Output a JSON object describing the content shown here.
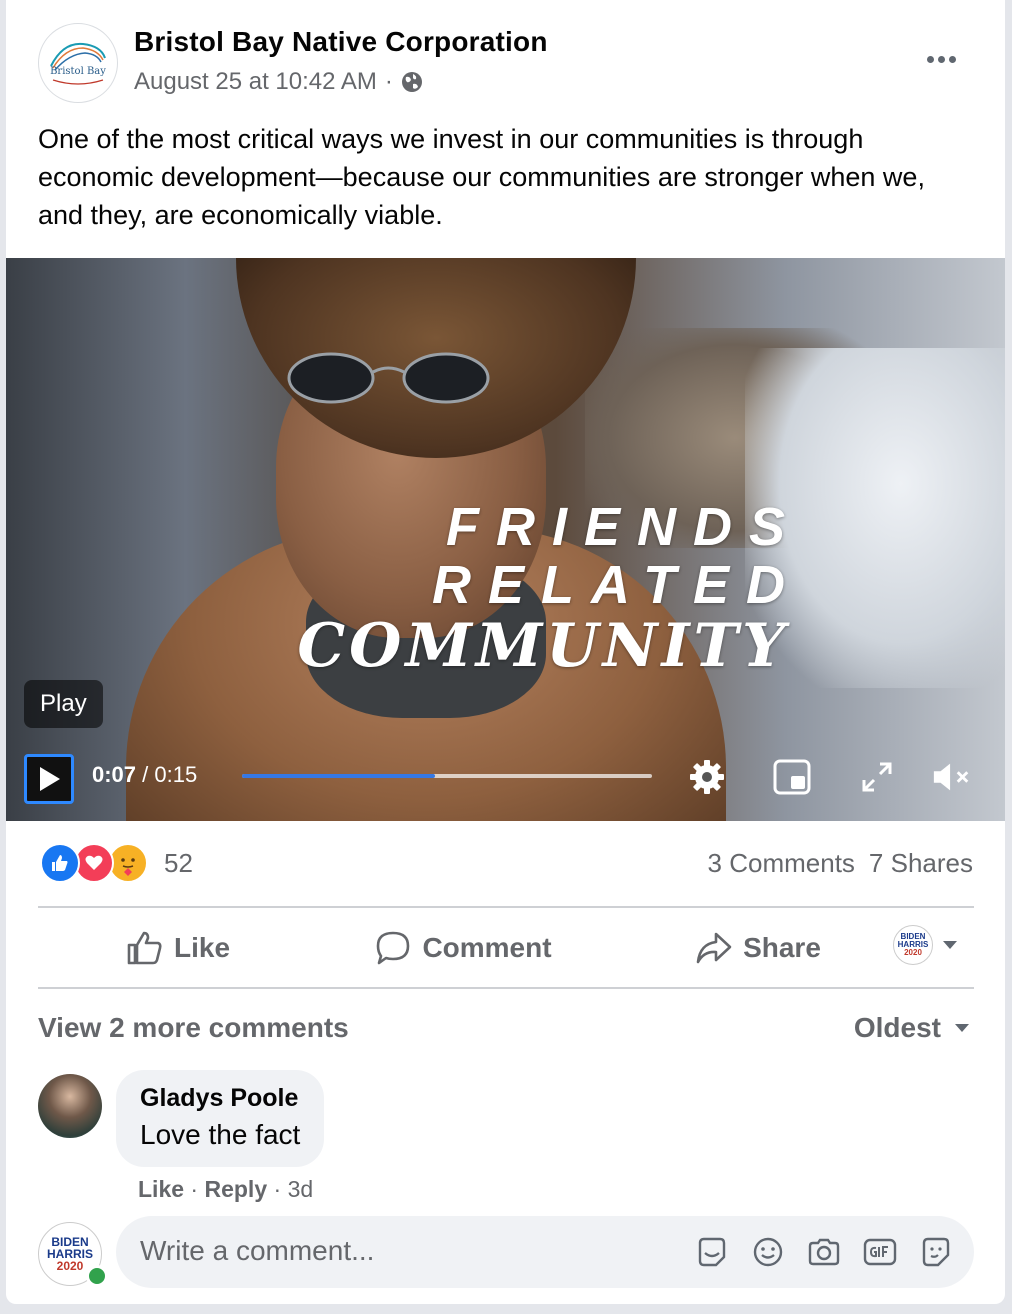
{
  "post": {
    "page_name": "Bristol Bay Native Corporation",
    "page_logo_text": "Bristol Bay",
    "timestamp": "August 25 at 10:42 AM",
    "meta_separator": "·",
    "privacy_icon": "globe-icon",
    "text": "One of the most critical ways we invest in our communities is through economic development—because our communities are stronger when we, and they, are economically viable."
  },
  "video": {
    "overlay_lines": [
      "FRIENDS",
      "RELATED",
      "COMMUNITY"
    ],
    "tooltip": "Play",
    "current_time": "0:07",
    "time_separator": " / ",
    "duration": "0:15",
    "progress": 0.47,
    "icons": [
      "play-icon",
      "settings-icon",
      "pip-icon",
      "fullscreen-icon",
      "muted-icon"
    ]
  },
  "stats": {
    "reactions": [
      "like",
      "love",
      "care"
    ],
    "reaction_count": "52",
    "comments": "3 Comments",
    "shares": "7 Shares"
  },
  "actions": {
    "like": "Like",
    "comment": "Comment",
    "share": "Share",
    "profile_badge": [
      "BIDEN",
      "HARRIS",
      "2020"
    ]
  },
  "comments": {
    "view_more": "View 2 more comments",
    "sort": "Oldest",
    "items": [
      {
        "author": "Gladys Poole",
        "text": "Love the fact",
        "like": "Like",
        "reply": "Reply",
        "age": "3d"
      }
    ],
    "input_placeholder": "Write a comment...",
    "input_icons": [
      "avatar-sticker-icon",
      "emoji-icon",
      "camera-icon",
      "gif-icon",
      "sticker-icon"
    ]
  },
  "colors": {
    "accent": "#1877f2",
    "progress": "#3578e5",
    "secondary_text": "#65676b",
    "online": "#31a24c"
  }
}
